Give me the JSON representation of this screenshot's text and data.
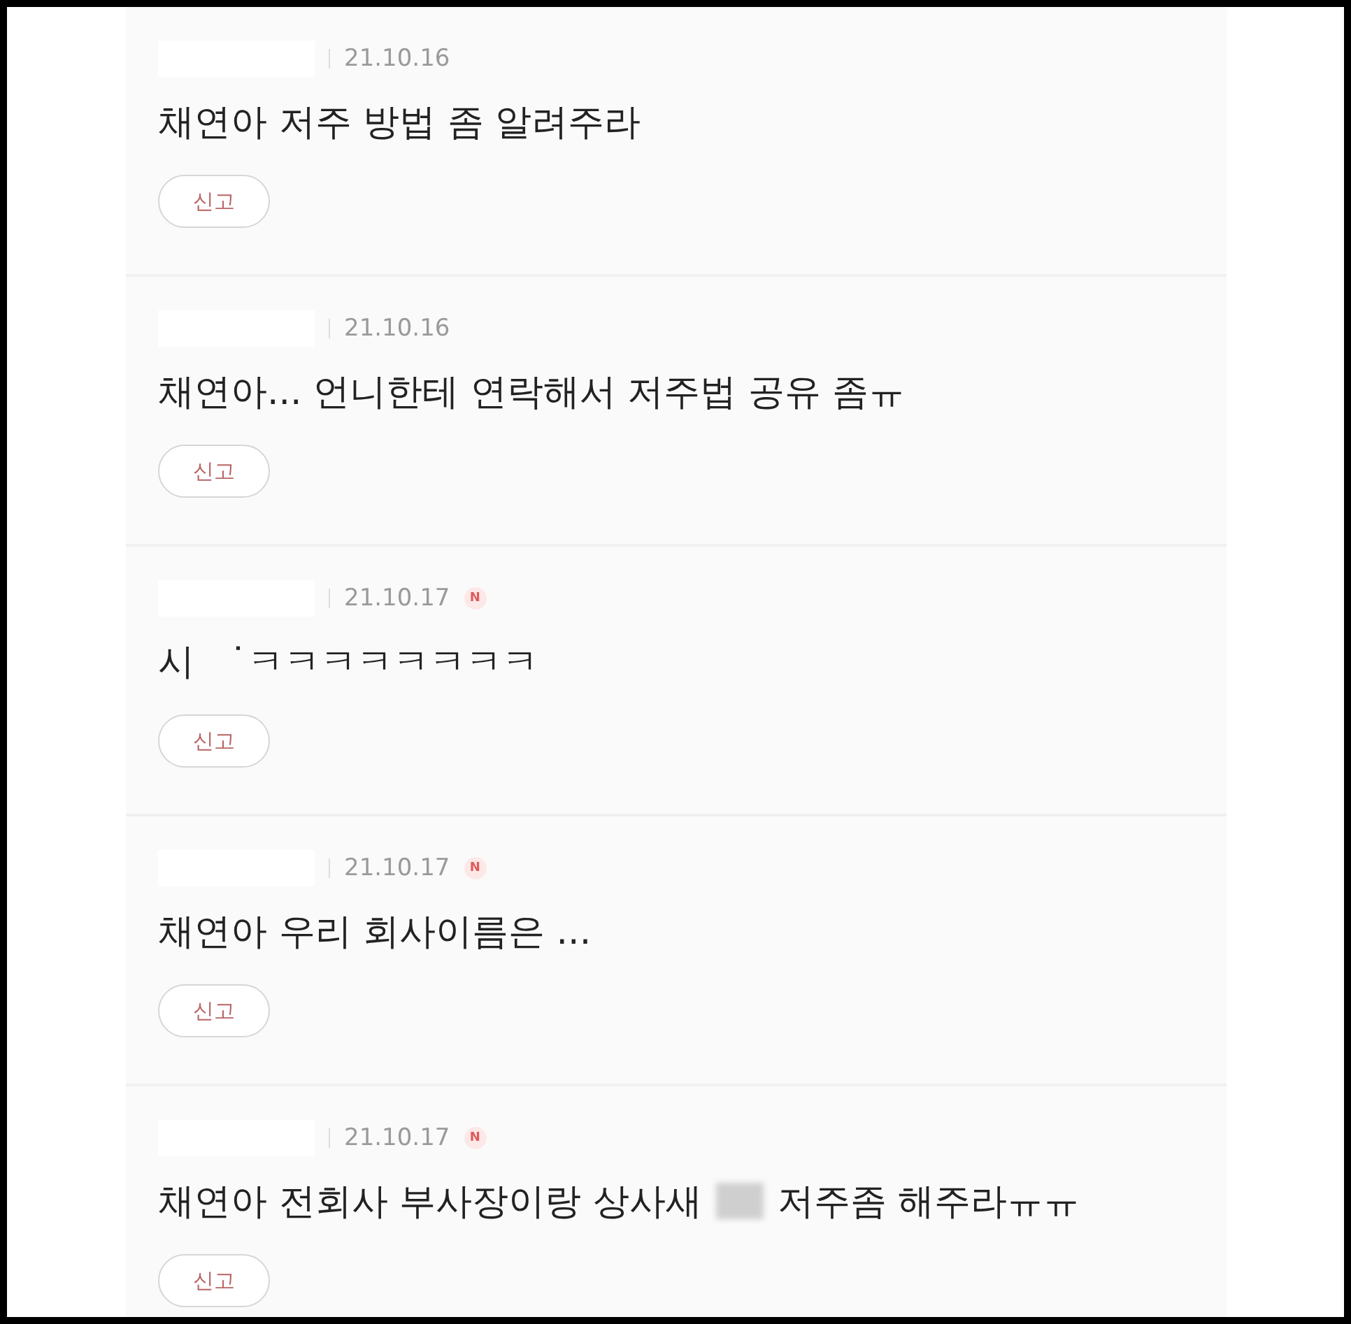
{
  "comments": [
    {
      "date": "21.10.16",
      "text": [
        "채연아 저주 방법 좀 알려주라"
      ],
      "report": "신고"
    },
    {
      "date": "21.10.16",
      "text": [
        "채연아... 언니한테 연락해서 저주법 공유 좀ㅠ"
      ],
      "report": "신고"
    },
    {
      "date": "21.10.17",
      "badge": "N",
      "text": [
        "시   ˙ㅋㅋㅋㅋㅋㅋㅋㅋ"
      ],
      "report": "신고"
    },
    {
      "date": "21.10.17",
      "badge": "N",
      "text": [
        "채연아 우리 회사이름은 ..."
      ],
      "report": "신고"
    },
    {
      "date": "21.10.17",
      "badge": "N",
      "text": [
        "채연아 전회사 부사장이랑 상사새",
        "저주좀 해주라ㅠㅠ"
      ],
      "report": "신고"
    }
  ]
}
